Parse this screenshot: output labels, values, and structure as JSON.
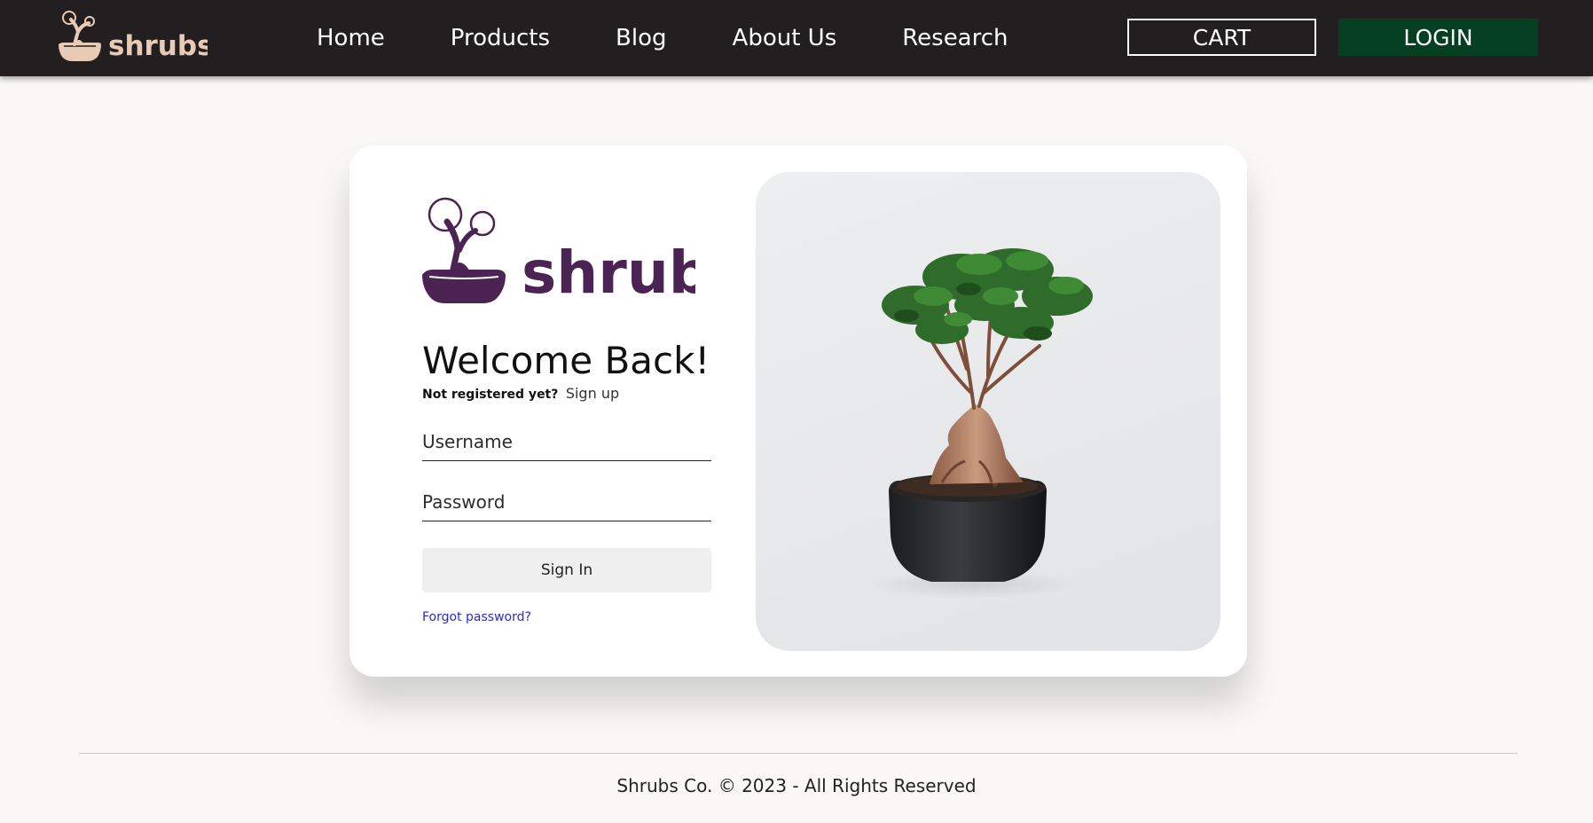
{
  "nav": {
    "brand": "shrubs",
    "links": [
      "Home",
      "Products",
      "Blog",
      "About Us",
      "Research"
    ],
    "cart_label": "CART",
    "login_label": "LOGIN"
  },
  "login": {
    "brand": "shrubs",
    "title": "Welcome Back!",
    "signup_prompt": "Not registered yet?",
    "signup_link": "Sign up",
    "username_placeholder": "Username",
    "password_placeholder": "Password",
    "signin_label": "Sign In",
    "forgot_label": "Forgot password?"
  },
  "footer": {
    "text": "Shrubs Co. © 2023 - All Rights Reserved"
  },
  "colors": {
    "nav_bg": "#231f20",
    "nav_logo": "#e8cbb5",
    "login_button_bg": "#043f22",
    "brand_purple": "#4b2453",
    "link_blue": "#2a2ad0",
    "page_bg": "#f9f8f6"
  },
  "icons": {
    "nav_logo": "bonsai-logo-icon",
    "card_logo": "bonsai-logo-icon"
  }
}
